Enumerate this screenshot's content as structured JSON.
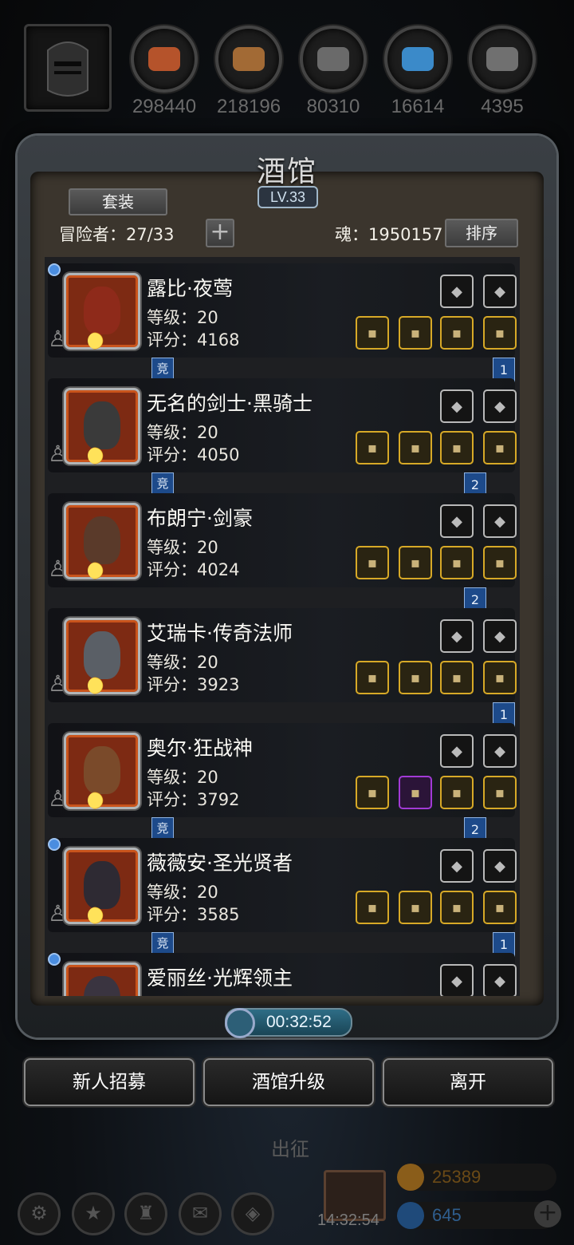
{
  "resources": [
    {
      "icon": "meat-icon",
      "value": "298440",
      "color": "#b5532b"
    },
    {
      "icon": "wood-icon",
      "value": "218196",
      "color": "#a26a35"
    },
    {
      "icon": "iron-icon",
      "value": "80310",
      "color": "#6a6a6a"
    },
    {
      "icon": "crystal-icon",
      "value": "16614",
      "color": "#3b8ac9"
    },
    {
      "icon": "stone-icon",
      "value": "4395",
      "color": "#707070"
    }
  ],
  "panel": {
    "title": "酒馆",
    "level": "LV.33",
    "suit_button": "套装",
    "adventurers_label": "冒险者：27/33",
    "soul_label": "魂：1950157",
    "sort_button": "排序"
  },
  "heroes": [
    {
      "name": "露比·夜莺",
      "level": "等级：20",
      "score": "评分：4168",
      "rank": "1",
      "has_tag": true,
      "tag": "竞",
      "dot": true,
      "portrait": "#8e2a1a"
    },
    {
      "name": "无名的剑士·黑骑士",
      "level": "等级：20",
      "score": "评分：4050",
      "rank": "2",
      "has_tag": true,
      "tag": "竞",
      "dot": false,
      "portrait": "#3a3a3a"
    },
    {
      "name": "布朗宁·剑豪",
      "level": "等级：20",
      "score": "评分：4024",
      "rank": "2",
      "has_tag": false,
      "tag": "",
      "dot": false,
      "portrait": "#5a3a2a"
    },
    {
      "name": "艾瑞卡·传奇法师",
      "level": "等级：20",
      "score": "评分：3923",
      "rank": "1",
      "has_tag": false,
      "tag": "",
      "dot": false,
      "portrait": "#5a5f66"
    },
    {
      "name": "奥尔·狂战神",
      "level": "等级：20",
      "score": "评分：3792",
      "rank": "2",
      "has_tag": true,
      "tag": "竞",
      "dot": false,
      "portrait": "#7a4a2a"
    },
    {
      "name": "薇薇安·圣光贤者",
      "level": "等级：20",
      "score": "评分：3585",
      "rank": "1",
      "has_tag": true,
      "tag": "竞",
      "dot": true,
      "portrait": "#2e2a33"
    },
    {
      "name": "爱丽丝·光辉领主",
      "level": "",
      "score": "",
      "rank": "",
      "has_tag": false,
      "tag": "",
      "dot": true,
      "portrait": "#3a3440"
    }
  ],
  "timer": "00:32:52",
  "actions": {
    "recruit": "新人招募",
    "upgrade": "酒馆升级",
    "leave": "离开"
  },
  "bottom": {
    "deploy": "出征",
    "clock": "14:32:54",
    "gold": "25389",
    "gems": "645"
  }
}
